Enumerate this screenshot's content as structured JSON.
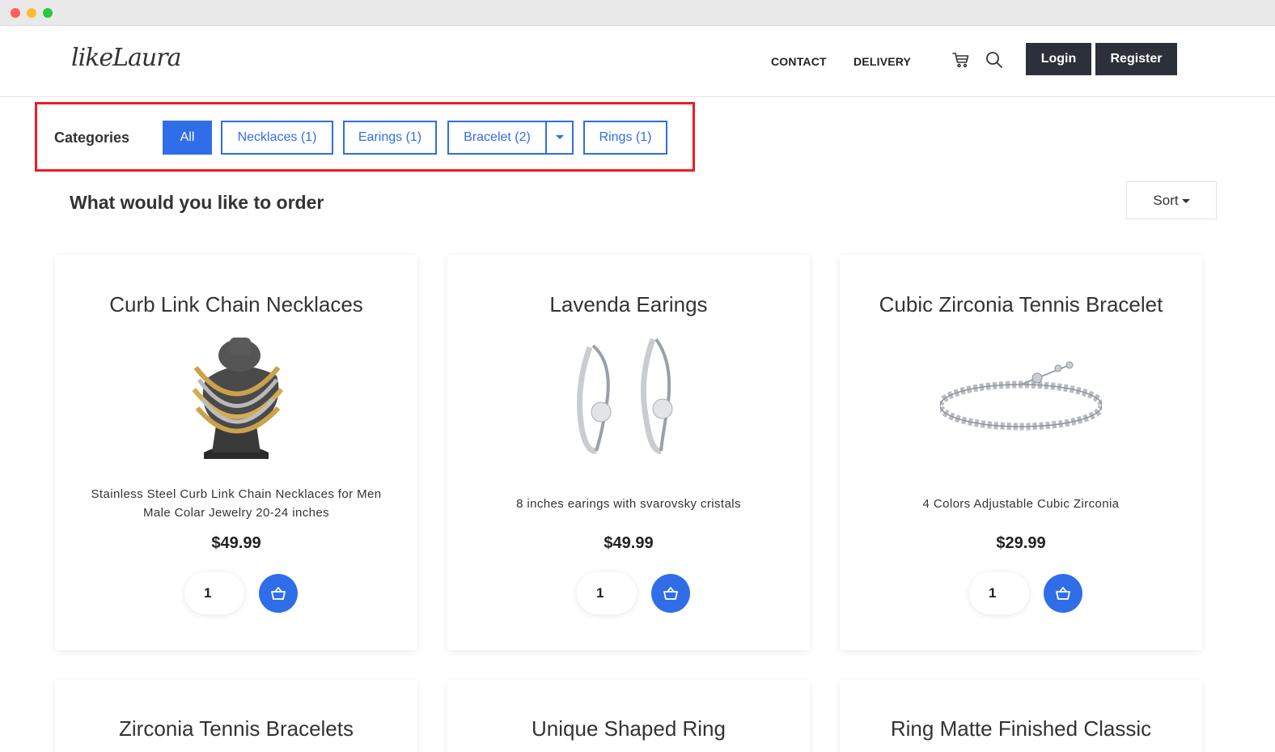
{
  "header": {
    "logo": "likeLaura",
    "nav": {
      "contact": "CONTACT",
      "delivery": "DELIVERY"
    },
    "login_label": "Login",
    "register_label": "Register"
  },
  "categories": {
    "label": "Categories",
    "items": [
      {
        "label": "All",
        "active": true
      },
      {
        "label": "Necklaces (1)"
      },
      {
        "label": "Earings (1)"
      },
      {
        "label": "Bracelet (2)"
      },
      {
        "label": "Rings (1)"
      }
    ]
  },
  "main": {
    "title": "What would you like to order",
    "sort_label": "Sort"
  },
  "products": [
    {
      "name": "Curb Link Chain Necklaces",
      "description": "Stainless Steel Curb Link Chain Necklaces for Men Male Colar Jewelry 20-24 inches",
      "price": "$49.99",
      "qty": "1"
    },
    {
      "name": "Lavenda Earings",
      "description": "8 inches earings with svarovsky cristals",
      "price": "$49.99",
      "qty": "1"
    },
    {
      "name": "Cubic Zirconia Tennis Bracelet",
      "description": "4 Colors Adjustable Cubic Zirconia",
      "price": "$29.99",
      "qty": "1"
    },
    {
      "name": "Zirconia Tennis Bracelets"
    },
    {
      "name": "Unique Shaped Ring"
    },
    {
      "name": "Ring Matte Finished Classic"
    }
  ],
  "colors": {
    "accent": "#2f6ee8",
    "dark": "#2b303b",
    "highlight": "#ee1b24"
  },
  "icons": [
    "cart-icon",
    "search-icon",
    "basket-icon",
    "caret-down-icon"
  ]
}
